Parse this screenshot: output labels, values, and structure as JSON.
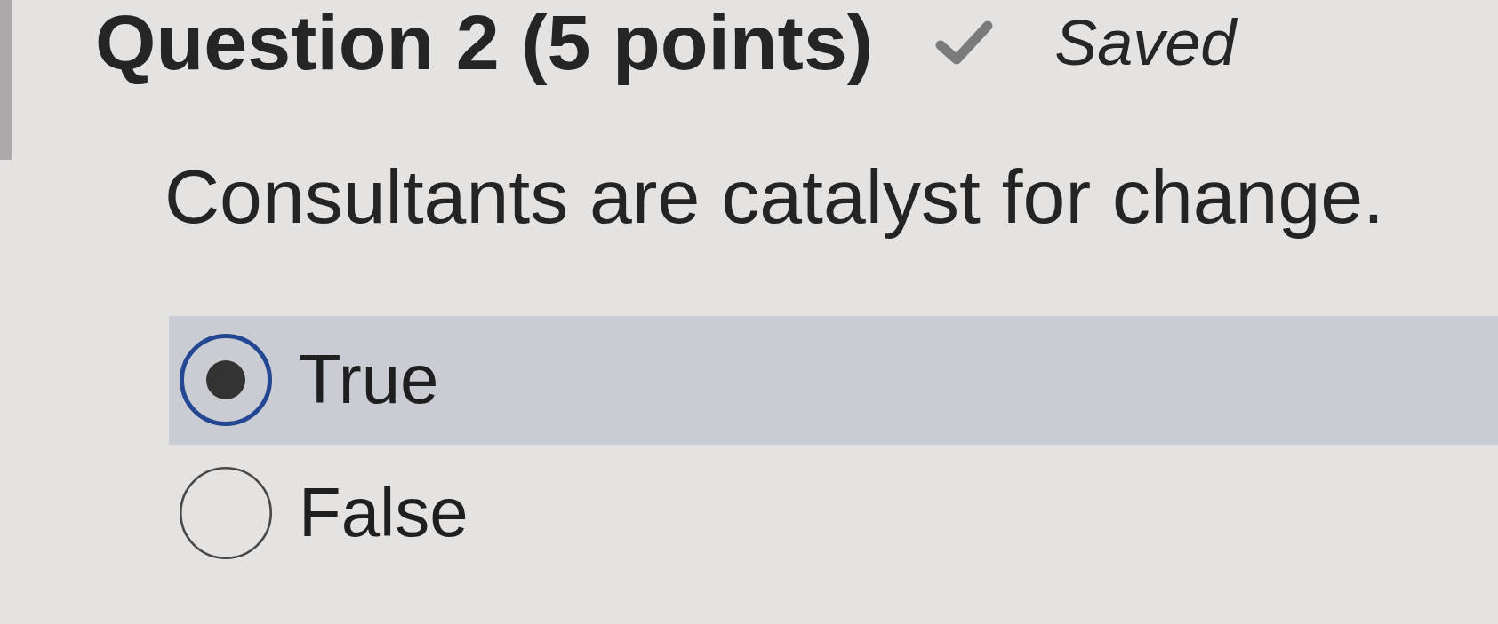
{
  "question": {
    "title": "Question 2 (5 points)",
    "status": {
      "saved": true,
      "label": "Saved"
    },
    "prompt": "Consultants are catalyst for change."
  },
  "options": [
    {
      "label": "True",
      "selected": true
    },
    {
      "label": "False",
      "selected": false
    }
  ]
}
